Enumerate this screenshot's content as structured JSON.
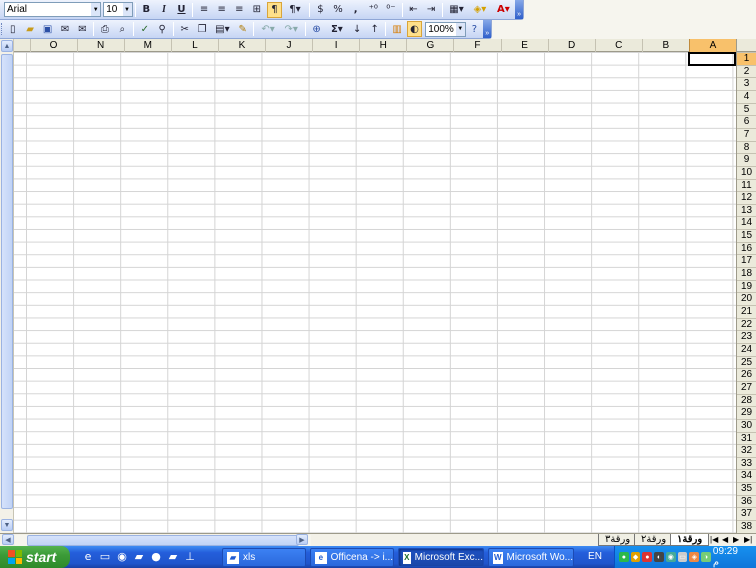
{
  "toolbar1": {
    "font_name": "Arial",
    "font_size": "10",
    "bold": "B",
    "italic": "I",
    "underline": "U",
    "currency": "%",
    "comma": ","
  },
  "toolbar2": {
    "zoom": "100%",
    "autosum": "Σ"
  },
  "columns": [
    "A",
    "B",
    "C",
    "D",
    "E",
    "F",
    "G",
    "H",
    "I",
    "J",
    "K",
    "L",
    "M",
    "N",
    "O"
  ],
  "selected_column": "A",
  "rows": [
    "1",
    "2",
    "3",
    "4",
    "5",
    "6",
    "7",
    "8",
    "9",
    "10",
    "11",
    "12",
    "13",
    "14",
    "15",
    "16",
    "17",
    "18",
    "19",
    "20",
    "21",
    "22",
    "23",
    "24",
    "25",
    "26",
    "27",
    "28",
    "29",
    "30",
    "31",
    "32",
    "33",
    "34",
    "35",
    "36",
    "37",
    "38"
  ],
  "selected_row": "1",
  "sheet_tabs": [
    "ورقة١",
    "ورقة٢",
    "ورقة٣"
  ],
  "active_tab": "ورقة١",
  "taskbar": {
    "start_label": "start",
    "tasks": [
      "xls",
      "Officena -> i...",
      "Microsoft Exc...",
      "Microsoft Wo..."
    ],
    "active_task": "Microsoft Exc...",
    "language": "EN",
    "clock": "09:29 م"
  },
  "colors": {
    "selected_header": "#f8c16b",
    "taskbar_blue": "#245edb",
    "start_green": "#3c9b38"
  }
}
